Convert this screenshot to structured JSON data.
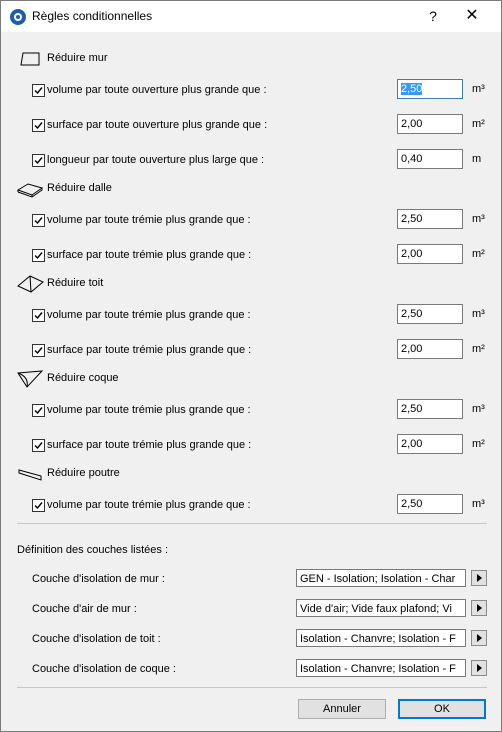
{
  "window": {
    "title": "Règles conditionnelles",
    "help": "?",
    "close": "✕"
  },
  "sections": [
    {
      "label": "Réduire mur",
      "icon": "wall-icon",
      "rows": [
        {
          "label": "volume par toute ouverture plus grande que :",
          "value": "2,50",
          "unit": "m³",
          "checked": true,
          "selected": true
        },
        {
          "label": "surface par toute ouverture plus grande que :",
          "value": "2,00",
          "unit": "m²",
          "checked": true
        },
        {
          "label": "longueur par toute ouverture plus large que :",
          "value": "0,40",
          "unit": "m",
          "checked": true
        }
      ]
    },
    {
      "label": "Réduire dalle",
      "icon": "slab-icon",
      "rows": [
        {
          "label": "volume par toute trémie plus grande que :",
          "value": "2,50",
          "unit": "m³",
          "checked": true
        },
        {
          "label": "surface par toute trémie plus grande que :",
          "value": "2,00",
          "unit": "m²",
          "checked": true
        }
      ]
    },
    {
      "label": "Réduire toit",
      "icon": "roof-icon",
      "rows": [
        {
          "label": "volume par toute trémie plus grande que :",
          "value": "2,50",
          "unit": "m³",
          "checked": true
        },
        {
          "label": "surface par toute trémie plus grande que :",
          "value": "2,00",
          "unit": "m²",
          "checked": true
        }
      ]
    },
    {
      "label": "Réduire coque",
      "icon": "shell-icon",
      "rows": [
        {
          "label": "volume par toute trémie plus grande que :",
          "value": "2,50",
          "unit": "m³",
          "checked": true
        },
        {
          "label": "surface par toute trémie plus grande que :",
          "value": "2,00",
          "unit": "m²",
          "checked": true
        }
      ]
    },
    {
      "label": "Réduire poutre",
      "icon": "beam-icon",
      "rows": [
        {
          "label": "volume par toute trémie plus grande que :",
          "value": "2,50",
          "unit": "m³",
          "checked": true
        }
      ]
    }
  ],
  "definition": {
    "title": "Définition des couches listées :",
    "layers": [
      {
        "label": "Couche d'isolation de mur :",
        "value": "GEN - Isolation; Isolation - Char"
      },
      {
        "label": "Couche d'air de mur :",
        "value": "Vide d'air; Vide faux plafond; Vi"
      },
      {
        "label": "Couche d'isolation de toit :",
        "value": "Isolation - Chanvre; Isolation - F"
      },
      {
        "label": "Couche d'isolation de coque :",
        "value": "Isolation - Chanvre; Isolation - F"
      }
    ]
  },
  "buttons": {
    "cancel": "Annuler",
    "ok": "OK"
  }
}
